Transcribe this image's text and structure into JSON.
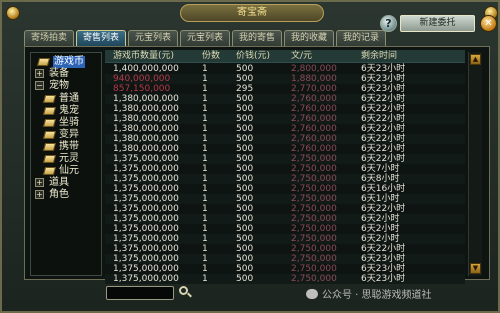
{
  "window": {
    "title": "寄宝斋"
  },
  "header": {
    "help_label": "?",
    "new_request_label": "新建委托",
    "close_label": "✕"
  },
  "tabs": [
    {
      "label": "寄场拍卖"
    },
    {
      "label": "寄售列表"
    },
    {
      "label": "元宝列表"
    },
    {
      "label": "元宝列表"
    },
    {
      "label": "我的寄售"
    },
    {
      "label": "我的收藏"
    },
    {
      "label": "我的记录"
    }
  ],
  "tree": [
    {
      "label": "游戏币",
      "expander": "",
      "icon": true,
      "selected": true
    },
    {
      "label": "装备",
      "expander": "+",
      "icon": false
    },
    {
      "label": "宠物",
      "expander": "−",
      "icon": false
    },
    {
      "label": "普通",
      "expander": "",
      "icon": true
    },
    {
      "label": "鬼宠",
      "expander": "",
      "icon": true
    },
    {
      "label": "坐骑",
      "expander": "",
      "icon": true
    },
    {
      "label": "变异",
      "expander": "",
      "icon": true
    },
    {
      "label": "携带",
      "expander": "",
      "icon": true
    },
    {
      "label": "元灵",
      "expander": "",
      "icon": true
    },
    {
      "label": "仙元",
      "expander": "",
      "icon": true
    },
    {
      "label": "道具",
      "expander": "+",
      "icon": false
    },
    {
      "label": "角色",
      "expander": "+",
      "icon": false
    }
  ],
  "table": {
    "headers": [
      "游戏币数量(元)",
      "份数",
      "价钱(元)",
      "文/元",
      "剩余时间"
    ],
    "rows": [
      {
        "amount": "1,400,000,000",
        "shares": "1",
        "price": "500",
        "ratio": "2,800,000",
        "time": "6天23小时",
        "red": false
      },
      {
        "amount": "940,000,000",
        "shares": "1",
        "price": "500",
        "ratio": "1,880,000",
        "time": "6天23小时",
        "red": true
      },
      {
        "amount": "857,150,000",
        "shares": "1",
        "price": "295",
        "ratio": "2,770,000",
        "time": "6天23小时",
        "red": true
      },
      {
        "amount": "1,380,000,000",
        "shares": "1",
        "price": "500",
        "ratio": "2,760,000",
        "time": "6天22小时",
        "red": false
      },
      {
        "amount": "1,380,000,000",
        "shares": "1",
        "price": "500",
        "ratio": "2,760,000",
        "time": "6天22小时",
        "red": false
      },
      {
        "amount": "1,380,000,000",
        "shares": "1",
        "price": "500",
        "ratio": "2,760,000",
        "time": "6天22小时",
        "red": false
      },
      {
        "amount": "1,380,000,000",
        "shares": "1",
        "price": "500",
        "ratio": "2,760,000",
        "time": "6天22小时",
        "red": false
      },
      {
        "amount": "1,380,000,000",
        "shares": "1",
        "price": "500",
        "ratio": "2,760,000",
        "time": "6天22小时",
        "red": false
      },
      {
        "amount": "1,380,000,000",
        "shares": "1",
        "price": "500",
        "ratio": "2,760,000",
        "time": "6天22小时",
        "red": false
      },
      {
        "amount": "1,375,000,000",
        "shares": "1",
        "price": "500",
        "ratio": "2,750,000",
        "time": "6天22小时",
        "red": false
      },
      {
        "amount": "1,375,000,000",
        "shares": "1",
        "price": "500",
        "ratio": "2,750,000",
        "time": "6天7小时",
        "red": false
      },
      {
        "amount": "1,375,000,000",
        "shares": "1",
        "price": "500",
        "ratio": "2,750,000",
        "time": "6天8小时",
        "red": false
      },
      {
        "amount": "1,375,000,000",
        "shares": "1",
        "price": "500",
        "ratio": "2,750,000",
        "time": "6天16小时",
        "red": false
      },
      {
        "amount": "1,375,000,000",
        "shares": "1",
        "price": "500",
        "ratio": "2,750,000",
        "time": "6天1小时",
        "red": false
      },
      {
        "amount": "1,375,000,000",
        "shares": "1",
        "price": "500",
        "ratio": "2,750,000",
        "time": "6天22小时",
        "red": false
      },
      {
        "amount": "1,375,000,000",
        "shares": "1",
        "price": "500",
        "ratio": "2,750,000",
        "time": "6天2小时",
        "red": false
      },
      {
        "amount": "1,375,000,000",
        "shares": "1",
        "price": "500",
        "ratio": "2,750,000",
        "time": "6天2小时",
        "red": false
      },
      {
        "amount": "1,375,000,000",
        "shares": "1",
        "price": "500",
        "ratio": "2,750,000",
        "time": "6天2小时",
        "red": false
      },
      {
        "amount": "1,375,000,000",
        "shares": "1",
        "price": "500",
        "ratio": "2,750,000",
        "time": "6天22小时",
        "red": false
      },
      {
        "amount": "1,375,000,000",
        "shares": "1",
        "price": "500",
        "ratio": "2,750,000",
        "time": "6天23小时",
        "red": false
      },
      {
        "amount": "1,375,000,000",
        "shares": "1",
        "price": "500",
        "ratio": "2,750,000",
        "time": "6天23小时",
        "red": false
      },
      {
        "amount": "1,375,000,000",
        "shares": "1",
        "price": "500",
        "ratio": "2,750,000",
        "time": "6天23小时",
        "red": false
      }
    ]
  },
  "search": {
    "placeholder": ""
  },
  "watermark": {
    "text": "公众号 · 思聪游戏频道社"
  }
}
